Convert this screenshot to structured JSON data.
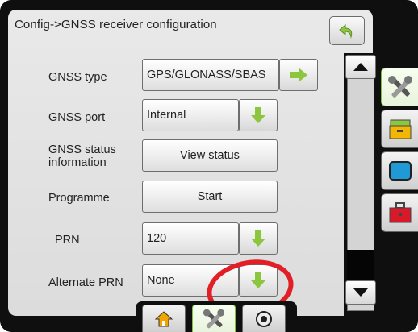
{
  "header": {
    "title": "Config->GNSS receiver configuration"
  },
  "rows": [
    {
      "label": "GNSS type",
      "value": "GPS/GLONASS/SBAS",
      "action_icon": "arrow-right-icon"
    },
    {
      "label": "GNSS port",
      "value": "Internal",
      "action_icon": "arrow-down-icon"
    },
    {
      "label": "GNSS status information",
      "value": "View status"
    },
    {
      "label": "Programme",
      "value": "Start"
    },
    {
      "label": "PRN",
      "value": "120",
      "action_icon": "arrow-down-icon"
    },
    {
      "label": "Alternate PRN",
      "value": "None",
      "action_icon": "arrow-down-icon"
    }
  ],
  "side_tabs": [
    {
      "icon": "tools-icon",
      "active": true
    },
    {
      "icon": "folder-drawer-icon",
      "active": false
    },
    {
      "icon": "display-icon",
      "active": false
    },
    {
      "icon": "toolbox-icon",
      "active": false
    }
  ],
  "bottom_tabs": [
    {
      "icon": "home-icon",
      "active": false
    },
    {
      "icon": "tools-icon",
      "active": true
    },
    {
      "icon": "gauge-icon",
      "active": false
    }
  ],
  "colors": {
    "accent_green": "#8cc63f",
    "highlight_red": "#e01f26",
    "frame": "#0f0f0f"
  }
}
